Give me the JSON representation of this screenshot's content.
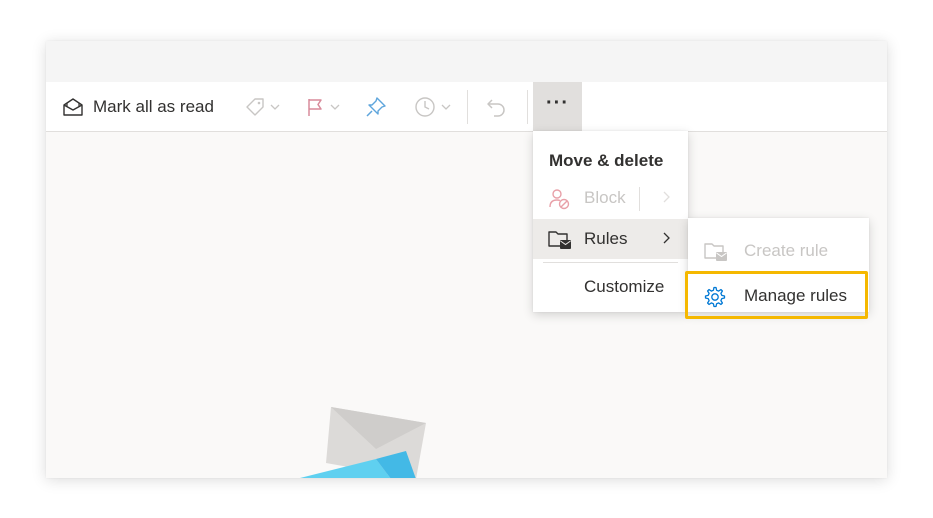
{
  "toolbar": {
    "mark_all_read_label": "Mark all as read",
    "icons": [
      "envelope-open-icon",
      "tag-icon",
      "flag-icon",
      "pin-icon",
      "clock-icon",
      "undo-icon",
      "more-icon"
    ],
    "more_label": "···"
  },
  "menu": {
    "header": "Move & delete",
    "items": [
      {
        "label": "Block",
        "icon": "block-user-icon",
        "disabled": true
      },
      {
        "label": "Rules",
        "icon": "folder-rules-icon",
        "has_submenu": true,
        "hovered": true
      },
      {
        "label": "Customize"
      }
    ]
  },
  "submenu": {
    "items": [
      {
        "label": "Create rule",
        "icon": "folder-rules-icon",
        "disabled": true
      },
      {
        "label": "Manage rules",
        "icon": "gear-icon",
        "highlighted": true
      }
    ]
  },
  "colors": {
    "accent_blue": "#0078d4",
    "highlight_outline": "#f5b800",
    "flag_pink": "#d88a9a",
    "disabled_gray": "#c8c6c4",
    "text": "#323130"
  }
}
